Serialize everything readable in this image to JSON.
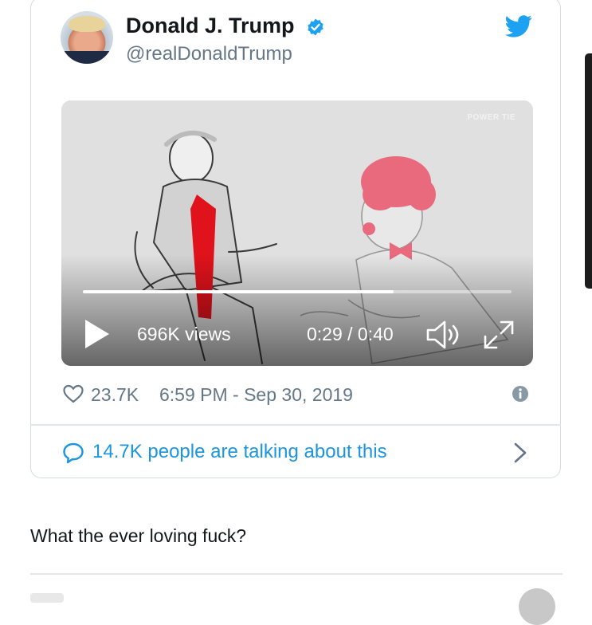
{
  "tweet": {
    "author_name": "Donald J. Trump",
    "handle": "@realDonaldTrump",
    "verified_icon": "verified-badge-icon",
    "brand_icon": "twitter-bird-icon",
    "accent_color": "#1da1f2"
  },
  "video": {
    "watermark": "POWER TIE",
    "views": "696K views",
    "time": "0:29 / 0:40",
    "progress": 0.725,
    "play_icon": "play-icon",
    "volume_icon": "volume-icon",
    "fullscreen_icon": "expand-icon"
  },
  "meta": {
    "likes": "23.7K",
    "timestamp": "6:59 PM - Sep 30, 2019",
    "like_icon": "heart-icon",
    "info_icon": "info-icon"
  },
  "conversation": {
    "label": "14.7K people are talking about this",
    "icon": "speech-bubble-icon",
    "chevron": "chevron-right-icon"
  },
  "comment": {
    "text": "What the ever loving fuck?"
  }
}
